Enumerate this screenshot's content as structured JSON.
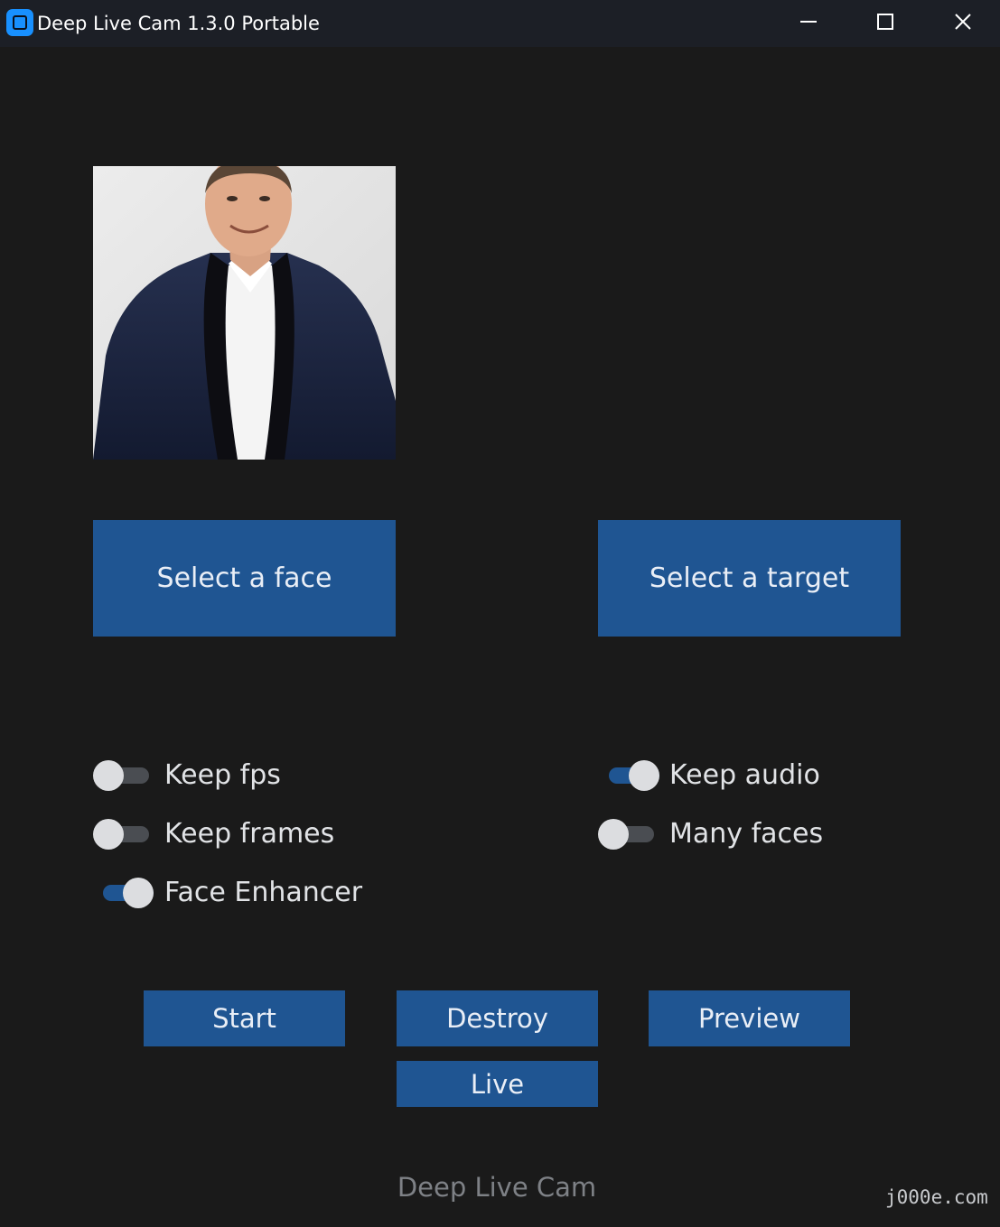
{
  "window": {
    "title": "Deep Live Cam 1.3.0 Portable",
    "controls": [
      "minimize-icon",
      "maximize-icon",
      "close-icon"
    ]
  },
  "source_image": {
    "description": "selected-face-photo"
  },
  "buttons": {
    "select_face": "Select a face",
    "select_target": "Select a target",
    "start": "Start",
    "destroy": "Destroy",
    "preview": "Preview",
    "live": "Live"
  },
  "toggles": {
    "keep_fps": {
      "label": "Keep fps",
      "on": false
    },
    "keep_frames": {
      "label": "Keep frames",
      "on": false
    },
    "face_enhancer": {
      "label": "Face Enhancer",
      "on": true
    },
    "keep_audio": {
      "label": "Keep audio",
      "on": true
    },
    "many_faces": {
      "label": "Many faces",
      "on": false
    }
  },
  "footer": {
    "title": "Deep Live Cam",
    "watermark": "j000e.com"
  },
  "colors": {
    "background": "#1a1a1a",
    "titlebar": "#1c1f26",
    "accent": "#1f5592",
    "switch_off_track": "#4a4d52",
    "switch_knob": "#dcdde0",
    "app_icon": "#1890ff"
  }
}
